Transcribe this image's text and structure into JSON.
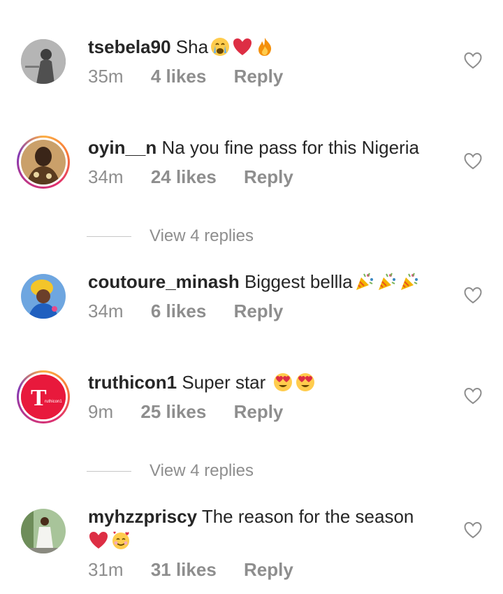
{
  "comments": [
    {
      "username": "tsebela90",
      "text": "Sha",
      "emoji": [
        "crying",
        "heart",
        "fire"
      ],
      "time": "35m",
      "likes": "4 likes",
      "reply": "Reply"
    },
    {
      "username": "oyin__n",
      "text": "Na you fine pass for this Nigeria",
      "emoji": [],
      "time": "34m",
      "likes": "24 likes",
      "reply": "Reply"
    },
    {
      "username": "coutoure_minash",
      "text": "Biggest bellla",
      "emoji": [
        "party-popper",
        "party-popper",
        "party-popper"
      ],
      "time": "34m",
      "likes": "6 likes",
      "reply": "Reply"
    },
    {
      "username": "truthicon1",
      "text": "Super star",
      "emoji": [
        "heart-eyes",
        "heart-eyes"
      ],
      "time": "9m",
      "likes": "25 likes",
      "reply": "Reply"
    },
    {
      "username": "myhzzpriscy",
      "text": "The reason for the season",
      "emoji": [
        "heart",
        "smiling-hearts"
      ],
      "time": "31m",
      "likes": "31 likes",
      "reply": "Reply"
    }
  ],
  "view_replies": [
    "View 4 replies",
    "View 4 replies"
  ],
  "colors": {
    "heart": "#ed1c24",
    "muted": "#8e8e8e",
    "text": "#262626",
    "story_ring": "#e1306c",
    "truthicon_brand": "#e8193c"
  }
}
